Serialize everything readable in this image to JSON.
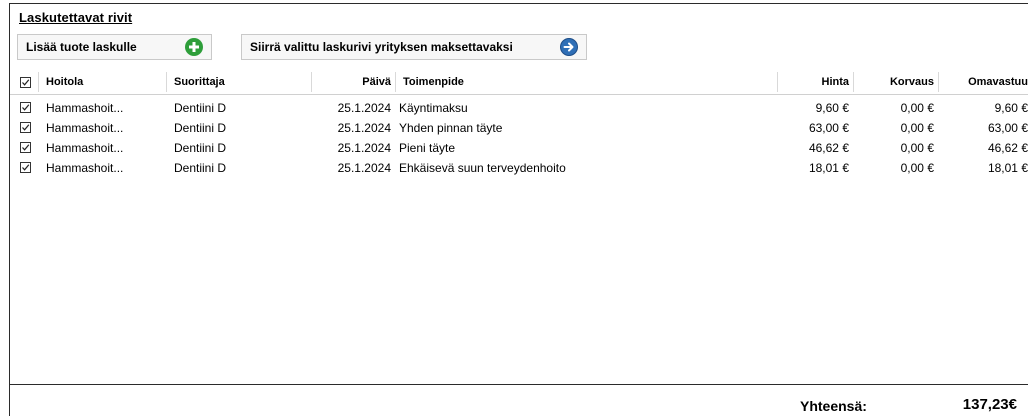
{
  "section_title": "Laskutettavat rivit",
  "buttons": {
    "add_product": "Lisää tuote laskulle",
    "move_row": "Siirrä valittu laskurivi yrityksen maksettavaksi"
  },
  "columns": {
    "hoitola": "Hoitola",
    "suorittaja": "Suorittaja",
    "paiva": "Päivä",
    "toimenpide": "Toimenpide",
    "hinta": "Hinta",
    "korvaus": "Korvaus",
    "omavastuu": "Omavastuu"
  },
  "rows": [
    {
      "checked": true,
      "hoitola": "Hammashoit...",
      "suorittaja": "Dentiini D",
      "paiva": "25.1.2024",
      "toimenpide": "Käyntimaksu",
      "hinta": "9,60 €",
      "korvaus": "0,00 €",
      "omavastuu": "9,60 €"
    },
    {
      "checked": true,
      "hoitola": "Hammashoit...",
      "suorittaja": "Dentiini D",
      "paiva": "25.1.2024",
      "toimenpide": "Yhden pinnan täyte",
      "hinta": "63,00 €",
      "korvaus": "0,00 €",
      "omavastuu": "63,00 €"
    },
    {
      "checked": true,
      "hoitola": "Hammashoit...",
      "suorittaja": "Dentiini D",
      "paiva": "25.1.2024",
      "toimenpide": "Pieni täyte",
      "hinta": "46,62 €",
      "korvaus": "0,00 €",
      "omavastuu": "46,62 €"
    },
    {
      "checked": true,
      "hoitola": "Hammashoit...",
      "suorittaja": "Dentiini D",
      "paiva": "25.1.2024",
      "toimenpide": "Ehkäisevä suun terveydenhoito",
      "hinta": "18,01 €",
      "korvaus": "0,00 €",
      "omavastuu": "18,01 €"
    }
  ],
  "footer": {
    "total_label": "Yhteensä:",
    "total_value": "137,23€"
  },
  "icons": {
    "add": "plus-circle-icon",
    "move": "arrow-right-circle-icon"
  },
  "colors": {
    "add_icon": "#2e9e3a",
    "move_icon": "#2f6fb6"
  }
}
